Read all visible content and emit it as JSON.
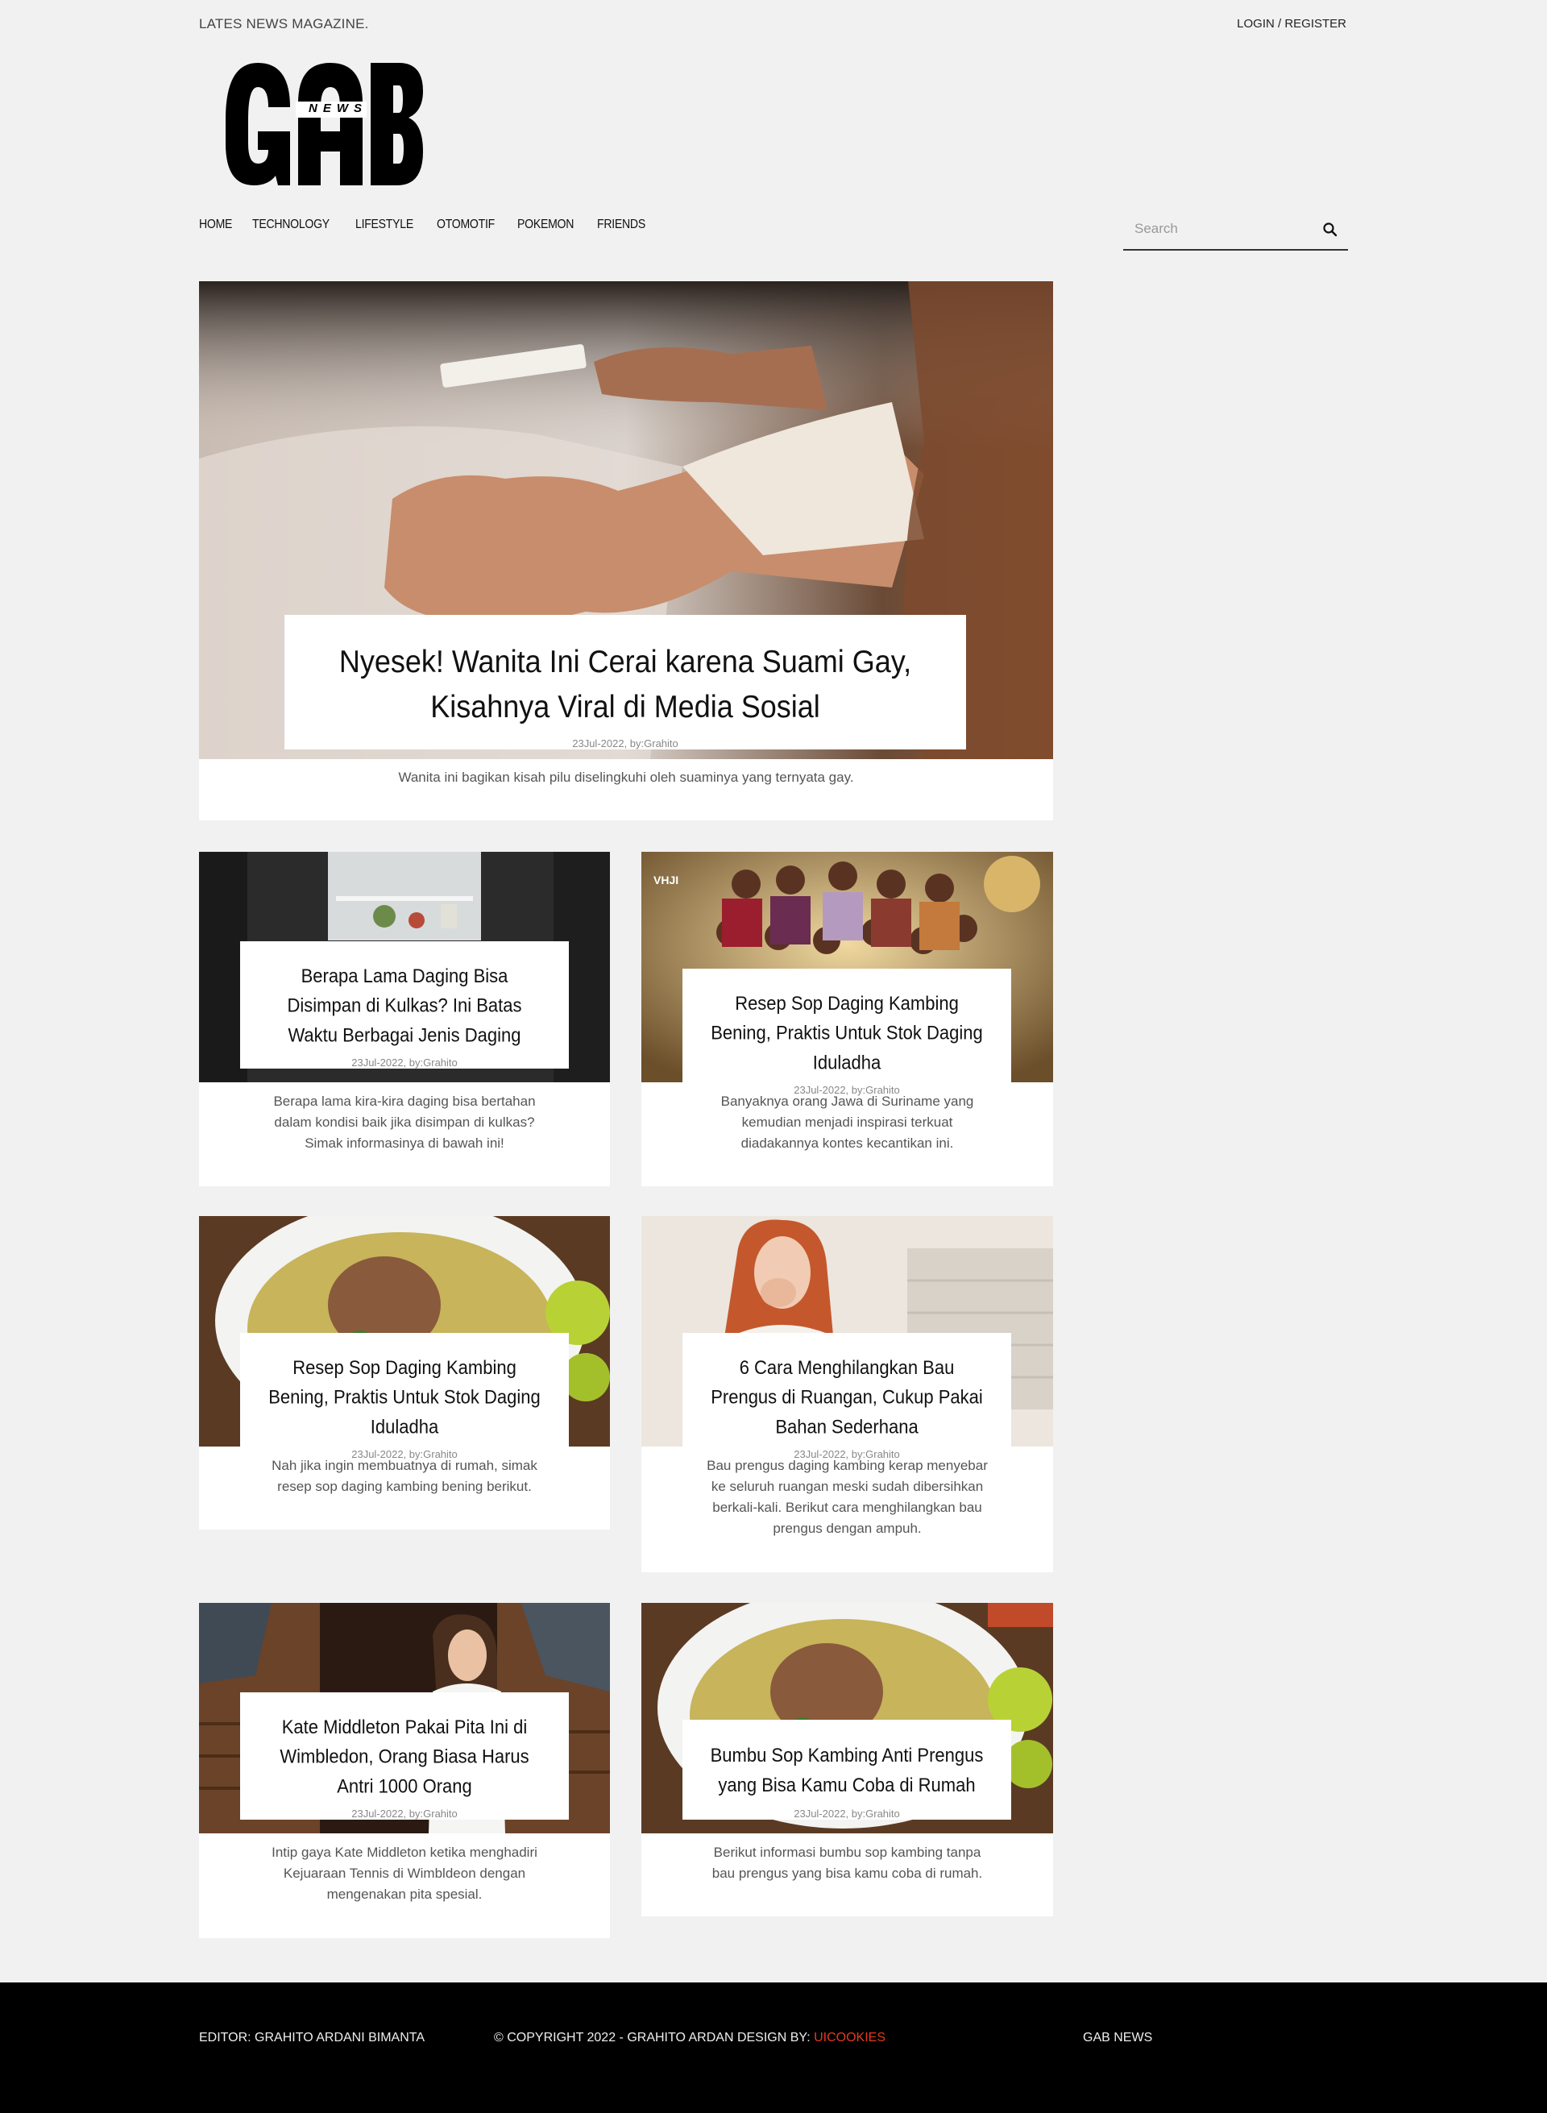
{
  "header": {
    "tagline": "LATES NEWS MAGAZINE.",
    "login": "LOGIN / REGISTER",
    "logo": {
      "main": "GAB",
      "sub": "NEWS"
    }
  },
  "nav": {
    "items": [
      "HOME",
      "TECHNOLOGY",
      "LIFESTYLE",
      "OTOMOTIF",
      "POKEMON",
      "FRIENDS"
    ],
    "search_placeholder": "Search"
  },
  "hero": {
    "title": "Nyesek! Wanita Ini Cerai karena Suami Gay, Kisahnya Viral di Media Sosial",
    "meta": "23Jul-2022, by:Grahito",
    "excerpt": "Wanita ini bagikan kisah pilu diselingkuhi oleh suaminya yang ternyata gay."
  },
  "articles": [
    {
      "title": "Berapa Lama Daging Bisa Disimpan di Kulkas? Ini Batas Waktu Berbagai Jenis Daging",
      "meta": "23Jul-2022, by:Grahito",
      "excerpt": "Berapa lama kira-kira daging bisa bertahan dalam kondisi baik jika disimpan di kulkas? Simak informasinya di bawah ini!"
    },
    {
      "title": "Resep Sop Daging Kambing Bening, Praktis Untuk Stok Daging Iduladha",
      "meta": "23Jul-2022, by:Grahito",
      "excerpt": "Banyaknya orang Jawa di Suriname yang kemudian menjadi inspirasi terkuat diadakannya kontes kecantikan ini."
    },
    {
      "title": "Resep Sop Daging Kambing Bening, Praktis Untuk Stok Daging Iduladha",
      "meta": "23Jul-2022, by:Grahito",
      "excerpt": "Nah jika ingin membuatnya di rumah, simak resep sop daging kambing bening berikut."
    },
    {
      "title": "6 Cara Menghilangkan Bau Prengus di Ruangan, Cukup Pakai Bahan Sederhana",
      "meta": "23Jul-2022, by:Grahito",
      "excerpt": "Bau prengus daging kambing kerap menyebar ke seluruh ruangan meski sudah dibersihkan berkali-kali. Berikut cara menghilangkan bau prengus dengan ampuh."
    },
    {
      "title": "Kate Middleton Pakai Pita Ini di Wimbledon, Orang Biasa Harus Antri 1000 Orang",
      "meta": "23Jul-2022, by:Grahito",
      "excerpt": "Intip gaya Kate Middleton ketika menghadiri Kejuaraan Tennis di Wimbldeon dengan mengenakan pita spesial."
    },
    {
      "title": "Bumbu Sop Kambing Anti Prengus yang Bisa Kamu Coba di Rumah",
      "meta": "23Jul-2022, by:Grahito",
      "excerpt": "Berikut informasi bumbu sop kambing tanpa bau prengus yang bisa kamu coba di rumah."
    }
  ],
  "footer": {
    "editor": "EDITOR: GRAHITO ARDANI BIMANTA",
    "copyright": "© COPYRIGHT 2022 - GRAHITO ARDAN DESIGN BY: ",
    "design_brand": "UICOOKIES",
    "site": "GAB NEWS"
  },
  "colors": {
    "accent": "#e53a1c",
    "footer_bg": "#000000",
    "page_bg": "#f1f1f1"
  }
}
